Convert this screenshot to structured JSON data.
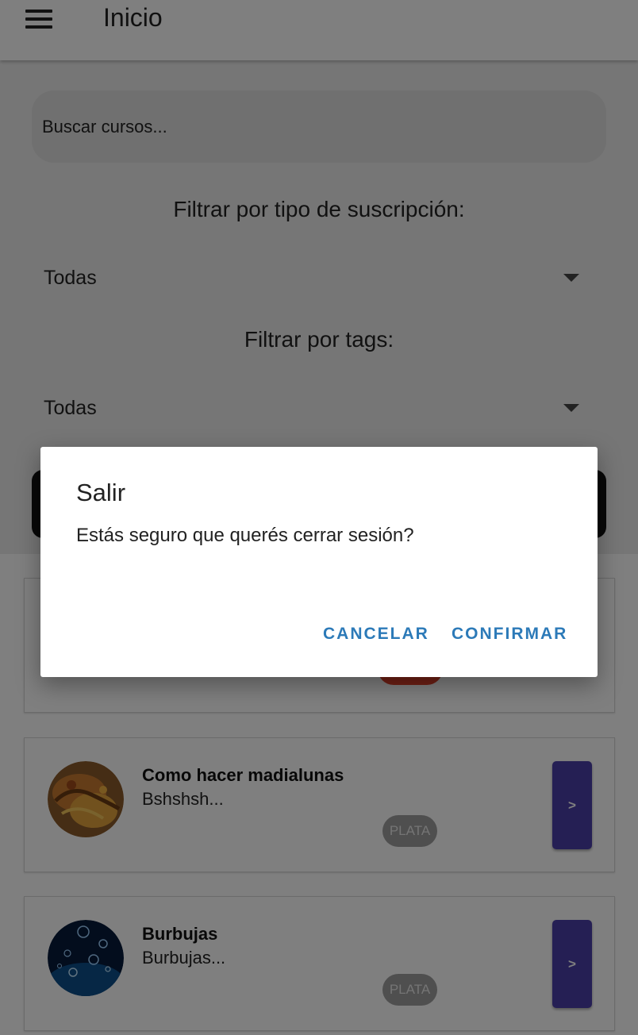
{
  "appbar": {
    "title": "Inicio"
  },
  "search": {
    "placeholder": "Buscar cursos..."
  },
  "filters": {
    "subscription_label": "Filtrar por tipo de suscripción:",
    "subscription_value": "Todas",
    "tags_label": "Filtrar por tags:",
    "tags_value": "Todas"
  },
  "courses": [
    {
      "title": "",
      "description": "",
      "badge": ""
    },
    {
      "title": "Como hacer madialunas",
      "description": "Bshshsh...",
      "badge": "PLATA",
      "button": ">"
    },
    {
      "title": "Burbujas",
      "description": "Burbujas...",
      "badge": "PLATA",
      "button": ">"
    }
  ],
  "dialog": {
    "title": "Salir",
    "message": "Estás seguro que querés cerrar sesión?",
    "cancel_label": "CANCELAR",
    "confirm_label": "CONFIRMAR"
  },
  "colors": {
    "accent_button": "#4a3ea8",
    "dialog_action": "#2c7ab8",
    "badge_gold_red": "#e0412a"
  },
  "icons": {
    "menu": "hamburger-menu-icon",
    "select_caret": "caret-down-icon"
  }
}
